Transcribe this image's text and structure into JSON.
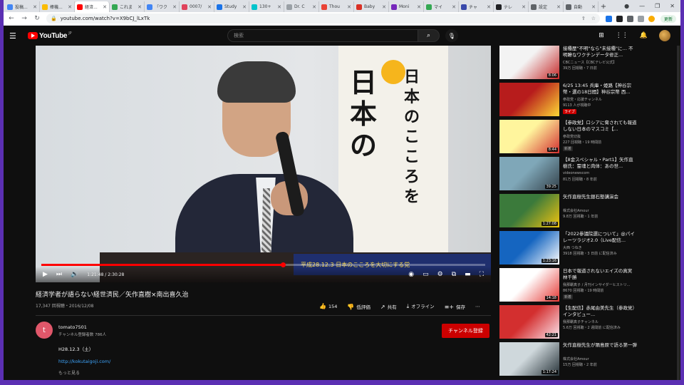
{
  "browser": {
    "tabs": [
      {
        "label": "投稿...",
        "color": "#4285f4",
        "active": false
      },
      {
        "label": "棒機...",
        "color": "#fbbc04",
        "active": false
      },
      {
        "label": "経済...",
        "color": "#ff0000",
        "active": true
      },
      {
        "label": "これま",
        "color": "#34a853",
        "active": false
      },
      {
        "label": "「ワク",
        "color": "#4285f4",
        "active": false
      },
      {
        "label": "0007/",
        "color": "#e0435c",
        "active": false
      },
      {
        "label": "Study",
        "color": "#1a73e8",
        "active": false
      },
      {
        "label": "130+",
        "color": "#00c4cc",
        "active": false
      },
      {
        "label": "Dr. C",
        "color": "#9aa0a6",
        "active": false
      },
      {
        "label": "Thou",
        "color": "#ea4335",
        "active": false
      },
      {
        "label": "Baby",
        "color": "#d93025",
        "active": false
      },
      {
        "label": "Moni",
        "color": "#7627bb",
        "active": false
      },
      {
        "label": "マイ",
        "color": "#34a853",
        "active": false
      },
      {
        "label": "チャ",
        "color": "#3949ab",
        "active": false
      },
      {
        "label": "テレ",
        "color": "#202124",
        "active": false
      },
      {
        "label": "設定",
        "color": "#5f6368",
        "active": false
      },
      {
        "label": "自動",
        "color": "#5f6368",
        "active": false
      }
    ],
    "url": "youtube.com/watch?v=X9bCJ_lLxTk",
    "update_label": "更新"
  },
  "masthead": {
    "logo_text": "YouTube",
    "logo_region": "JP",
    "search_placeholder": "検索"
  },
  "player": {
    "time_current": "1:21:48",
    "time_total": "2:30:28",
    "progress": 0.544,
    "overlay_text": "平成28.12.3 日本のこころを大切にする党"
  },
  "video": {
    "title": "経済学者が語らない経世済民／矢作直樹×南出喜久治",
    "views_date": "17,347 回視聴・2016/12/08",
    "likes": "154",
    "dislike_label": "低評価",
    "share_label": "共有",
    "offline_label": "オフライン",
    "save_label": "保存"
  },
  "channel": {
    "initial": "t",
    "name": "tomato7501",
    "subs": "チャンネル登録者数 786人",
    "subscribe_label": "チャンネル登録",
    "desc_line": "H28.12.3（土）",
    "desc_link": "http://kokutaigoji.com/",
    "more_label": "もっと見る"
  },
  "recommendations": [
    {
      "title": "接種歴\"不明\"なら\"未接種\"に… 不明瞭なワクチンデータ修正...",
      "channel": "CBCニュース【CBCテレビ公式】",
      "views": "39万 回視聴・7 日前",
      "duration": "8:06",
      "badge": "",
      "thumb_colors": [
        "#f3f3f3",
        "#c62828"
      ]
    },
    {
      "title": "6/25 13:45 兵庫・姫路【神谷宗幣・選の18日間】神谷宗幣 西...",
      "channel": "参政党・応援チャンネル",
      "views": "9113 人が視聴中",
      "duration": "",
      "badge": "ライブ",
      "thumb_colors": [
        "#b71c1c",
        "#fdd835"
      ]
    },
    {
      "title": "【参政党】ロシアに脅されても報道しない日本のマスコミ【...",
      "channel": "参政党切抜",
      "views": "227 回視聴・19 時間前",
      "duration": "8:44",
      "badge": "新着",
      "thumb_colors": [
        "#fff59d",
        "#d32f2f"
      ]
    },
    {
      "title": "【8金スペシャル・Part1】矢作直樹氏：霊魂と肉体：あの世...",
      "channel": "videonewscom",
      "views": "81万 回視聴・8 年前",
      "duration": "39:25",
      "badge": "",
      "thumb_colors": [
        "#7fa7b8",
        "#33414a"
      ]
    },
    {
      "title": "矢作直樹先生銀石塾講演会",
      "channel": "株式会社Amour",
      "views": "9.8万 回視聴・1 年前",
      "duration": "1:27:08",
      "badge": "",
      "thumb_colors": [
        "#3b7a3b",
        "#f1c40f"
      ]
    },
    {
      "title": "「2022参議院選について」@パイレーツラジオ2.0（Live配信...",
      "channel": "大西 つねき",
      "views": "3918 回視聴・3 日前 に配信済み",
      "duration": "1:23:16",
      "badge": "",
      "thumb_colors": [
        "#1565c0",
        "#ffffff"
      ]
    },
    {
      "title": "日本で報道されないエイズの真実 林千勝",
      "channel": "我那覇真子 / 月刊インサイダーヒストリ...",
      "views": "8670 回視聴・19 時間前",
      "duration": "14:18",
      "badge": "新着",
      "thumb_colors": [
        "#ffffff",
        "#e53935"
      ]
    },
    {
      "title": "【生配信】赤尾由美先生（参政党）インタビュー...",
      "channel": "我那覇真子チャンネル",
      "views": "5.6万 回視聴・2 週間前 に配信済み",
      "duration": "42:21",
      "badge": "",
      "thumb_colors": [
        "#d32f2f",
        "#fce4ec"
      ]
    },
    {
      "title": "矢作直樹先生が隕島原で語る第一弾",
      "channel": "株式会社Amour",
      "views": "15万 回視聴・2 年前",
      "duration": "1:17:24",
      "badge": "",
      "thumb_colors": [
        "#cfd8dc",
        "#263238"
      ]
    }
  ]
}
